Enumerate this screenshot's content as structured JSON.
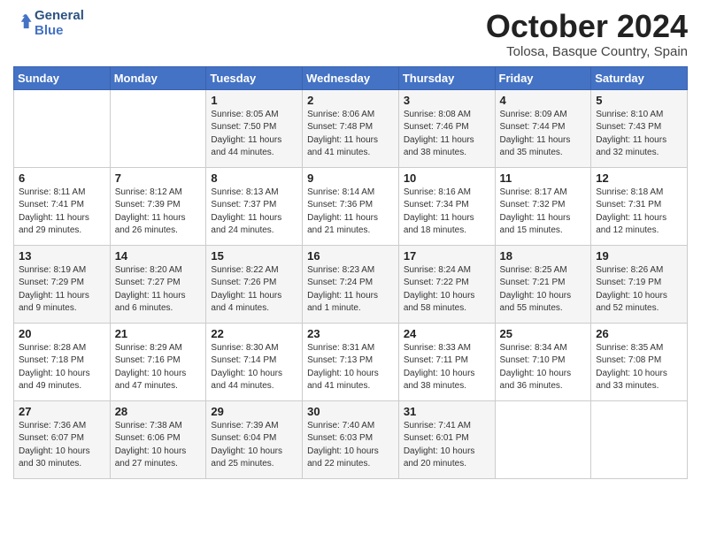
{
  "header": {
    "logo_line1": "General",
    "logo_line2": "Blue",
    "month_title": "October 2024",
    "location": "Tolosa, Basque Country, Spain"
  },
  "days_of_week": [
    "Sunday",
    "Monday",
    "Tuesday",
    "Wednesday",
    "Thursday",
    "Friday",
    "Saturday"
  ],
  "weeks": [
    [
      {
        "day": "",
        "sunrise": "",
        "sunset": "",
        "daylight": ""
      },
      {
        "day": "",
        "sunrise": "",
        "sunset": "",
        "daylight": ""
      },
      {
        "day": "1",
        "sunrise": "Sunrise: 8:05 AM",
        "sunset": "Sunset: 7:50 PM",
        "daylight": "Daylight: 11 hours and 44 minutes."
      },
      {
        "day": "2",
        "sunrise": "Sunrise: 8:06 AM",
        "sunset": "Sunset: 7:48 PM",
        "daylight": "Daylight: 11 hours and 41 minutes."
      },
      {
        "day": "3",
        "sunrise": "Sunrise: 8:08 AM",
        "sunset": "Sunset: 7:46 PM",
        "daylight": "Daylight: 11 hours and 38 minutes."
      },
      {
        "day": "4",
        "sunrise": "Sunrise: 8:09 AM",
        "sunset": "Sunset: 7:44 PM",
        "daylight": "Daylight: 11 hours and 35 minutes."
      },
      {
        "day": "5",
        "sunrise": "Sunrise: 8:10 AM",
        "sunset": "Sunset: 7:43 PM",
        "daylight": "Daylight: 11 hours and 32 minutes."
      }
    ],
    [
      {
        "day": "6",
        "sunrise": "Sunrise: 8:11 AM",
        "sunset": "Sunset: 7:41 PM",
        "daylight": "Daylight: 11 hours and 29 minutes."
      },
      {
        "day": "7",
        "sunrise": "Sunrise: 8:12 AM",
        "sunset": "Sunset: 7:39 PM",
        "daylight": "Daylight: 11 hours and 26 minutes."
      },
      {
        "day": "8",
        "sunrise": "Sunrise: 8:13 AM",
        "sunset": "Sunset: 7:37 PM",
        "daylight": "Daylight: 11 hours and 24 minutes."
      },
      {
        "day": "9",
        "sunrise": "Sunrise: 8:14 AM",
        "sunset": "Sunset: 7:36 PM",
        "daylight": "Daylight: 11 hours and 21 minutes."
      },
      {
        "day": "10",
        "sunrise": "Sunrise: 8:16 AM",
        "sunset": "Sunset: 7:34 PM",
        "daylight": "Daylight: 11 hours and 18 minutes."
      },
      {
        "day": "11",
        "sunrise": "Sunrise: 8:17 AM",
        "sunset": "Sunset: 7:32 PM",
        "daylight": "Daylight: 11 hours and 15 minutes."
      },
      {
        "day": "12",
        "sunrise": "Sunrise: 8:18 AM",
        "sunset": "Sunset: 7:31 PM",
        "daylight": "Daylight: 11 hours and 12 minutes."
      }
    ],
    [
      {
        "day": "13",
        "sunrise": "Sunrise: 8:19 AM",
        "sunset": "Sunset: 7:29 PM",
        "daylight": "Daylight: 11 hours and 9 minutes."
      },
      {
        "day": "14",
        "sunrise": "Sunrise: 8:20 AM",
        "sunset": "Sunset: 7:27 PM",
        "daylight": "Daylight: 11 hours and 6 minutes."
      },
      {
        "day": "15",
        "sunrise": "Sunrise: 8:22 AM",
        "sunset": "Sunset: 7:26 PM",
        "daylight": "Daylight: 11 hours and 4 minutes."
      },
      {
        "day": "16",
        "sunrise": "Sunrise: 8:23 AM",
        "sunset": "Sunset: 7:24 PM",
        "daylight": "Daylight: 11 hours and 1 minute."
      },
      {
        "day": "17",
        "sunrise": "Sunrise: 8:24 AM",
        "sunset": "Sunset: 7:22 PM",
        "daylight": "Daylight: 10 hours and 58 minutes."
      },
      {
        "day": "18",
        "sunrise": "Sunrise: 8:25 AM",
        "sunset": "Sunset: 7:21 PM",
        "daylight": "Daylight: 10 hours and 55 minutes."
      },
      {
        "day": "19",
        "sunrise": "Sunrise: 8:26 AM",
        "sunset": "Sunset: 7:19 PM",
        "daylight": "Daylight: 10 hours and 52 minutes."
      }
    ],
    [
      {
        "day": "20",
        "sunrise": "Sunrise: 8:28 AM",
        "sunset": "Sunset: 7:18 PM",
        "daylight": "Daylight: 10 hours and 49 minutes."
      },
      {
        "day": "21",
        "sunrise": "Sunrise: 8:29 AM",
        "sunset": "Sunset: 7:16 PM",
        "daylight": "Daylight: 10 hours and 47 minutes."
      },
      {
        "day": "22",
        "sunrise": "Sunrise: 8:30 AM",
        "sunset": "Sunset: 7:14 PM",
        "daylight": "Daylight: 10 hours and 44 minutes."
      },
      {
        "day": "23",
        "sunrise": "Sunrise: 8:31 AM",
        "sunset": "Sunset: 7:13 PM",
        "daylight": "Daylight: 10 hours and 41 minutes."
      },
      {
        "day": "24",
        "sunrise": "Sunrise: 8:33 AM",
        "sunset": "Sunset: 7:11 PM",
        "daylight": "Daylight: 10 hours and 38 minutes."
      },
      {
        "day": "25",
        "sunrise": "Sunrise: 8:34 AM",
        "sunset": "Sunset: 7:10 PM",
        "daylight": "Daylight: 10 hours and 36 minutes."
      },
      {
        "day": "26",
        "sunrise": "Sunrise: 8:35 AM",
        "sunset": "Sunset: 7:08 PM",
        "daylight": "Daylight: 10 hours and 33 minutes."
      }
    ],
    [
      {
        "day": "27",
        "sunrise": "Sunrise: 7:36 AM",
        "sunset": "Sunset: 6:07 PM",
        "daylight": "Daylight: 10 hours and 30 minutes."
      },
      {
        "day": "28",
        "sunrise": "Sunrise: 7:38 AM",
        "sunset": "Sunset: 6:06 PM",
        "daylight": "Daylight: 10 hours and 27 minutes."
      },
      {
        "day": "29",
        "sunrise": "Sunrise: 7:39 AM",
        "sunset": "Sunset: 6:04 PM",
        "daylight": "Daylight: 10 hours and 25 minutes."
      },
      {
        "day": "30",
        "sunrise": "Sunrise: 7:40 AM",
        "sunset": "Sunset: 6:03 PM",
        "daylight": "Daylight: 10 hours and 22 minutes."
      },
      {
        "day": "31",
        "sunrise": "Sunrise: 7:41 AM",
        "sunset": "Sunset: 6:01 PM",
        "daylight": "Daylight: 10 hours and 20 minutes."
      },
      {
        "day": "",
        "sunrise": "",
        "sunset": "",
        "daylight": ""
      },
      {
        "day": "",
        "sunrise": "",
        "sunset": "",
        "daylight": ""
      }
    ]
  ]
}
